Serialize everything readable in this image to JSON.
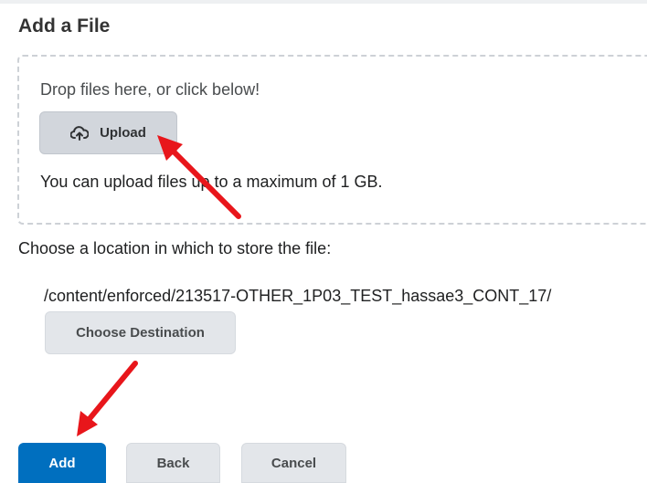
{
  "page": {
    "title": "Add a File"
  },
  "dropzone": {
    "prompt": "Drop files here, or click below!",
    "upload_label": "Upload",
    "upload_icon": "cloud-upload-icon",
    "limit_text": "You can upload files up to a maximum of 1 GB."
  },
  "location": {
    "prompt": "Choose a location in which to store the file:",
    "path": "/content/enforced/213517-OTHER_1P03_TEST_hassae3_CONT_17/",
    "choose_label": "Choose Destination"
  },
  "footer": {
    "add_label": "Add",
    "back_label": "Back",
    "cancel_label": "Cancel"
  },
  "colors": {
    "primary": "#006fbf",
    "annotation_arrow": "#e8161b"
  }
}
